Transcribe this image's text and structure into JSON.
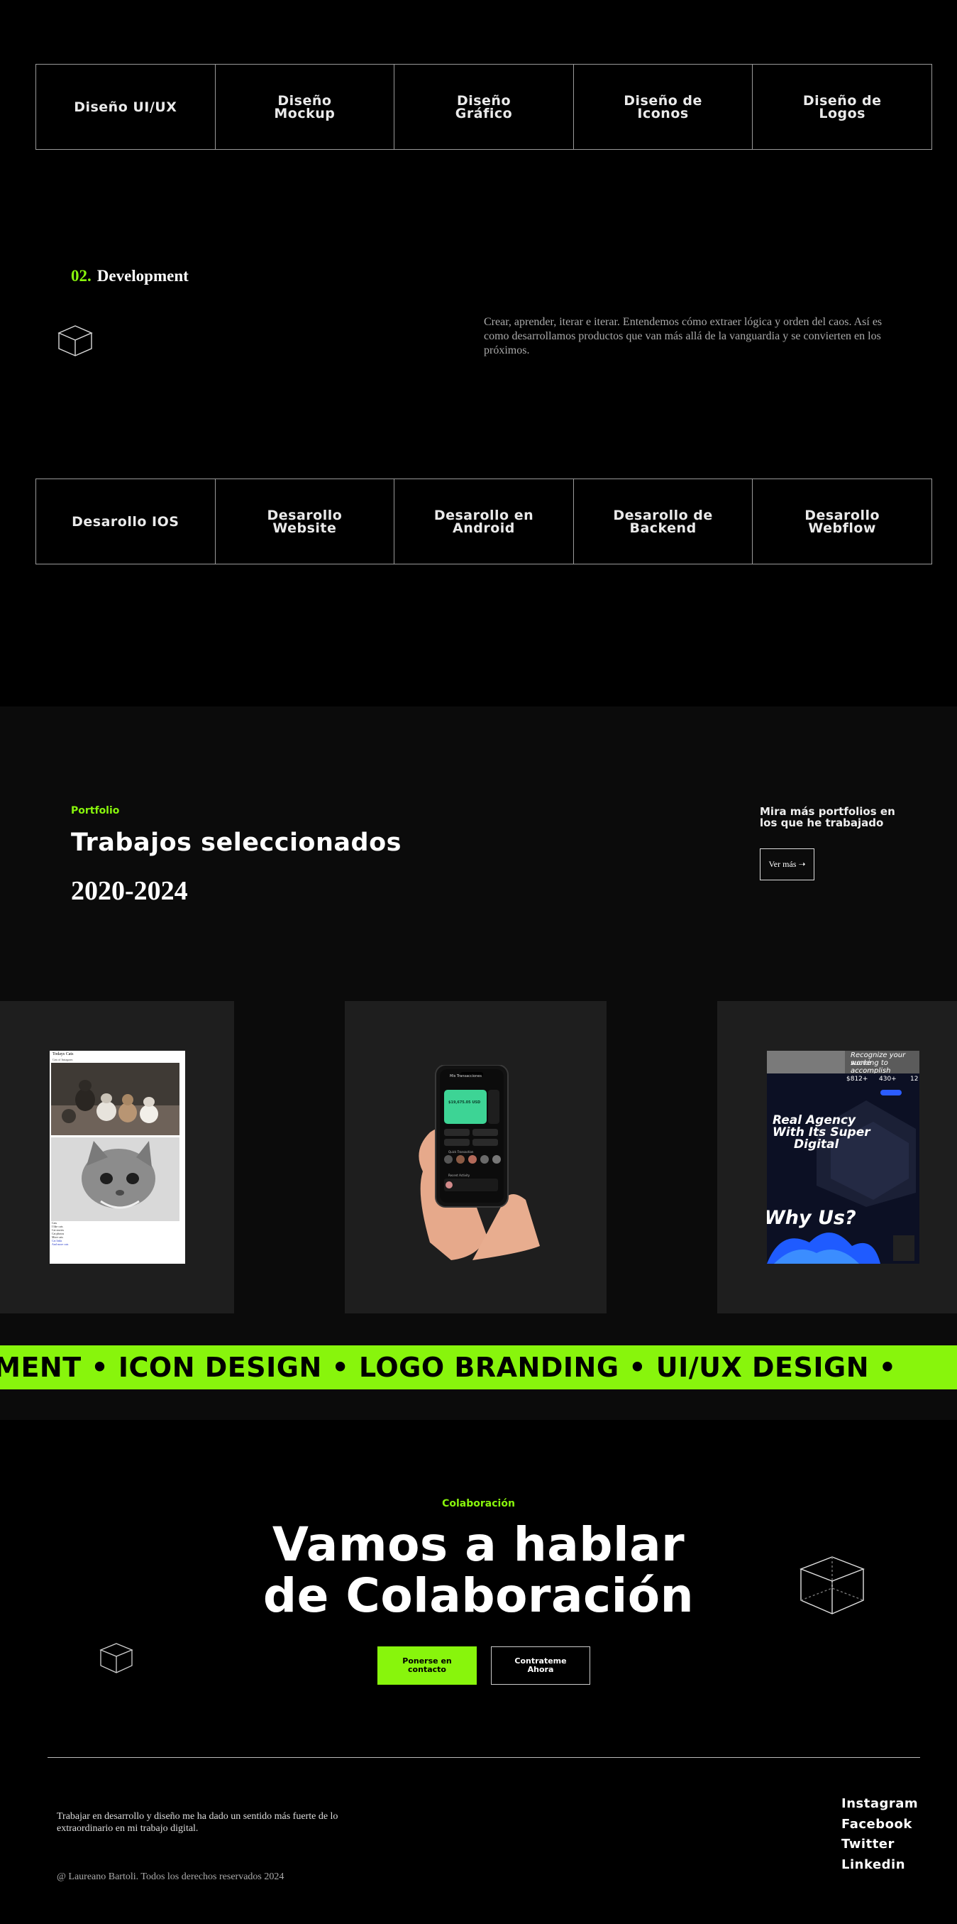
{
  "design_services": [
    "Diseño UI/UX",
    "Diseño\nMockup",
    "Diseño\nGráfico",
    "Diseño de\nIconos",
    "Diseño de\nLogos"
  ],
  "development": {
    "number": "02.",
    "title": "Development",
    "description": "Crear, aprender, iterar e iterar. Entendemos cómo extraer lógica y orden del caos. Así es como desarrollamos productos que van más allá de la vanguardia y se convierten en los próximos.",
    "services": [
      "Desarollo IOS",
      "Desarollo\nWebsite",
      "Desarollo en\nAndroid",
      "Desarollo de\nBackend",
      "Desarollo\nWebflow"
    ]
  },
  "portfolio": {
    "eyebrow": "Portfolio",
    "title": "Trabajos seleccionados",
    "years": "2020-2024",
    "more_text": "Mira más portfolios en los que he trabajado",
    "more_button": "Ver más ➝",
    "card1": {
      "heading": "Todays Cats",
      "subheading": "Cats of Instagram",
      "lines": [
        "Cats",
        "I like cats",
        "Cat stories",
        "Cat photos",
        "More cats",
        "Cat links",
        "And more cats"
      ]
    },
    "card2": {
      "app_title": "Mis Transacciones",
      "balance": "$19,675.05 USD",
      "quick": "Quick Transaction",
      "recent": "Recent Activity"
    },
    "card3": {
      "top_line1": "Recognize your succe",
      "top_line2": "working to accomplish",
      "stats": [
        "$812+",
        "430+",
        "12"
      ],
      "headline_lines": [
        "Real Agency",
        "With Its Super",
        "Digital"
      ],
      "why": "Why Us?"
    },
    "ticker": "OPMENT  •  ICON DESIGN  •  LOGO BRANDING  •  UI/UX DESIGN  •"
  },
  "collaboration": {
    "eyebrow": "Colaboración",
    "title_line1": "Vamos a hablar",
    "title_line2": "de Colaboración",
    "primary_button": "Ponerse en\ncontacto",
    "secondary_button": "Contrateme\nAhora"
  },
  "footer": {
    "text": "Trabajar en desarrollo y diseño me ha dado un sentido más fuerte de lo extraordinario en mi trabajo digital.",
    "copyright": "@ Laureano Bartoli. Todos los derechos reservados 2024",
    "social": [
      "Instagram",
      "Facebook",
      "Twitter",
      "Linkedin"
    ]
  },
  "colors": {
    "accent": "#88f50c",
    "background": "#000000",
    "section_bg": "#0b0b0b",
    "card_bg": "#1e1e1e"
  },
  "icons": [
    "cube-icon"
  ]
}
